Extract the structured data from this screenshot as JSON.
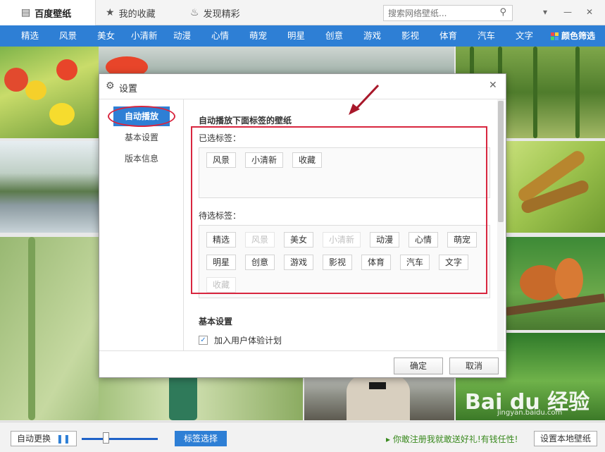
{
  "app": {
    "tabs": [
      {
        "label": "百度壁纸",
        "icon": "wallpaper-icon"
      },
      {
        "label": "我的收藏",
        "icon": "star-icon"
      },
      {
        "label": "发现精彩",
        "icon": "flame-icon"
      }
    ],
    "search_placeholder": "搜索网络壁纸..."
  },
  "categories": [
    "精选",
    "风景",
    "美女",
    "小清新",
    "动漫",
    "心情",
    "萌宠",
    "明星",
    "创意",
    "游戏",
    "影视",
    "体育",
    "汽车",
    "文字"
  ],
  "color_filter_label": "颜色筛选",
  "dialog": {
    "title": "设置",
    "nav": [
      "自动播放",
      "基本设置",
      "版本信息"
    ],
    "autoplay_title": "自动播放下面标签的壁纸",
    "selected_label": "已选标签：",
    "selected_tags": [
      "风景",
      "小清新",
      "收藏"
    ],
    "pending_label": "待选标签：",
    "pending_tags": [
      {
        "label": "精选",
        "disabled": false
      },
      {
        "label": "风景",
        "disabled": true
      },
      {
        "label": "美女",
        "disabled": false
      },
      {
        "label": "小清新",
        "disabled": true
      },
      {
        "label": "动漫",
        "disabled": false
      },
      {
        "label": "心情",
        "disabled": false
      },
      {
        "label": "萌宠",
        "disabled": false
      },
      {
        "label": "明星",
        "disabled": false
      },
      {
        "label": "创意",
        "disabled": false
      },
      {
        "label": "游戏",
        "disabled": false
      },
      {
        "label": "影视",
        "disabled": false
      },
      {
        "label": "体育",
        "disabled": false
      },
      {
        "label": "汽车",
        "disabled": false
      },
      {
        "label": "文字",
        "disabled": false
      },
      {
        "label": "收藏",
        "disabled": true
      }
    ],
    "basic_title": "基本设置",
    "user_experience_label": "加入用户体验计划",
    "user_experience_checked": true,
    "ok_label": "确定",
    "cancel_label": "取消"
  },
  "bottom": {
    "auto_change_label": "自动更换",
    "tag_select_label": "标签选择",
    "promo_text": "你敢注册我就敢送好礼!有钱任性!",
    "set_local_label": "设置本地壁纸"
  },
  "watermark": {
    "logo": "Bai du 经验",
    "url": "jingyan.baidu.com"
  },
  "colors": {
    "accent": "#2e7fd5",
    "annotation_red": "#d8263f"
  }
}
